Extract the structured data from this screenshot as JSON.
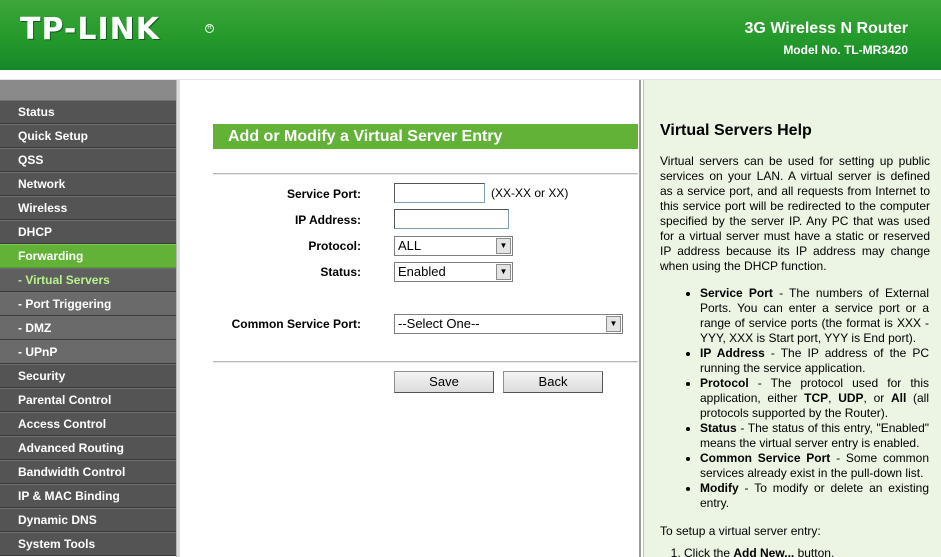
{
  "header": {
    "logo": "TP-LINK",
    "product": "3G Wireless N Router",
    "model": "Model No. TL-MR3420",
    "brand_color": "#249a2b"
  },
  "sidebar": {
    "items": [
      {
        "label": "Status"
      },
      {
        "label": "Quick Setup"
      },
      {
        "label": "QSS"
      },
      {
        "label": "Network"
      },
      {
        "label": "Wireless"
      },
      {
        "label": "DHCP"
      },
      {
        "label": "Forwarding"
      },
      {
        "label": "- Virtual Servers"
      },
      {
        "label": "- Port Triggering"
      },
      {
        "label": "- DMZ"
      },
      {
        "label": "- UPnP"
      },
      {
        "label": "Security"
      },
      {
        "label": "Parental Control"
      },
      {
        "label": "Access Control"
      },
      {
        "label": "Advanced Routing"
      },
      {
        "label": "Bandwidth Control"
      },
      {
        "label": "IP & MAC Binding"
      },
      {
        "label": "Dynamic DNS"
      },
      {
        "label": "System Tools"
      }
    ],
    "active_color": "#62b237"
  },
  "main": {
    "title": "Add or Modify a Virtual Server Entry",
    "service_port_label": "Service Port:",
    "service_port_value": "",
    "service_port_hint": "(XX-XX or XX)",
    "ip_address_label": "IP Address:",
    "ip_address_value": "",
    "protocol_label": "Protocol:",
    "protocol_value": "ALL",
    "status_label": "Status:",
    "status_value": "Enabled",
    "common_port_label": "Common Service Port:",
    "common_port_value": "--Select One--",
    "save_label": "Save",
    "back_label": "Back"
  },
  "help": {
    "title": "Virtual Servers Help",
    "intro": "Virtual servers can be used for setting up public services on your LAN. A virtual server is defined as a service port, and all requests from Internet to this service port will be redirected to the computer specified by the server IP. Any PC that was used for a virtual server must have a static or reserved IP address because its IP address may change when using the DHCP function.",
    "bullets": [
      {
        "term": "Service Port",
        "text": " - The numbers of External Ports. You can enter a service port or a range of service ports (the format is XXX - YYY, XXX is Start port, YYY is End port)."
      },
      {
        "term": "IP Address",
        "text": " - The IP address of the PC running the service application."
      },
      {
        "term": "Protocol",
        "text_a": " - The protocol used for this application, either ",
        "tcp": "TCP",
        "text_b": ", ",
        "udp": "UDP",
        "text_c": ", or ",
        "all": "All",
        "text_d": " (all protocols supported by the Router)."
      },
      {
        "term": "Status",
        "text": " - The status of this entry, \"Enabled\" means the virtual server entry is enabled."
      },
      {
        "term": "Common Service Port",
        "text": " - Some common services already exist in the pull-down list."
      },
      {
        "term": "Modify",
        "text": " - To modify or delete an existing entry."
      }
    ],
    "setup_heading": "To setup a virtual server entry:",
    "step1_a": "Click the ",
    "step1_b": "Add New...",
    "step1_c": " button."
  }
}
